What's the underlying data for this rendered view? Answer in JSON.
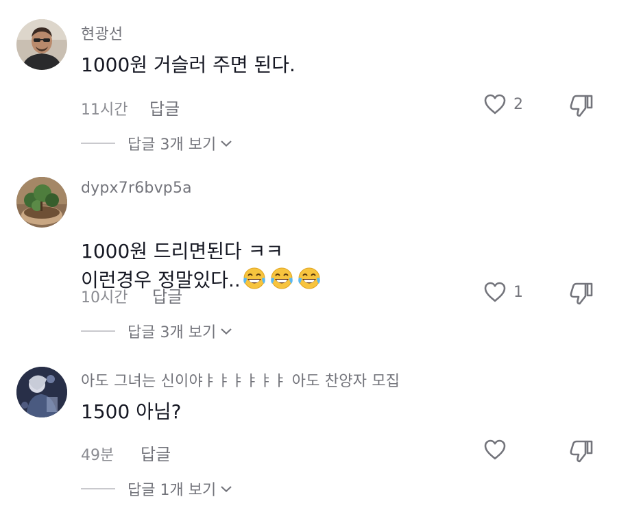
{
  "comments": [
    {
      "username": "현광선",
      "text": "1000원 거슬러 주면 된다.",
      "time": "11시간",
      "reply_label": "답글",
      "likes": "2",
      "view_replies": "답글 3개 보기"
    },
    {
      "username": "dypx7r6bvp5a",
      "text": "1000원 드리면된다 ㅋㅋ\n이런경우 정말있다..",
      "emoji": [
        "face-with-tears-of-joy",
        "face-with-tears-of-joy",
        "face-with-tears-of-joy"
      ],
      "time": "10시간",
      "reply_label": "답글",
      "likes": "1",
      "view_replies": "답글 3개 보기"
    },
    {
      "username": "아도 그녀는 신이야ㅑㅑㅑㅑㅑㅑ 아도 찬양자 모집",
      "text": "1500 아님?",
      "time": "49분",
      "reply_label": "답글",
      "likes": "",
      "view_replies": "답글 1개 보기"
    }
  ],
  "icons": {
    "like": "heart-outline-icon",
    "dislike": "thumbs-down-outline-icon",
    "expand": "chevron-down-icon"
  }
}
